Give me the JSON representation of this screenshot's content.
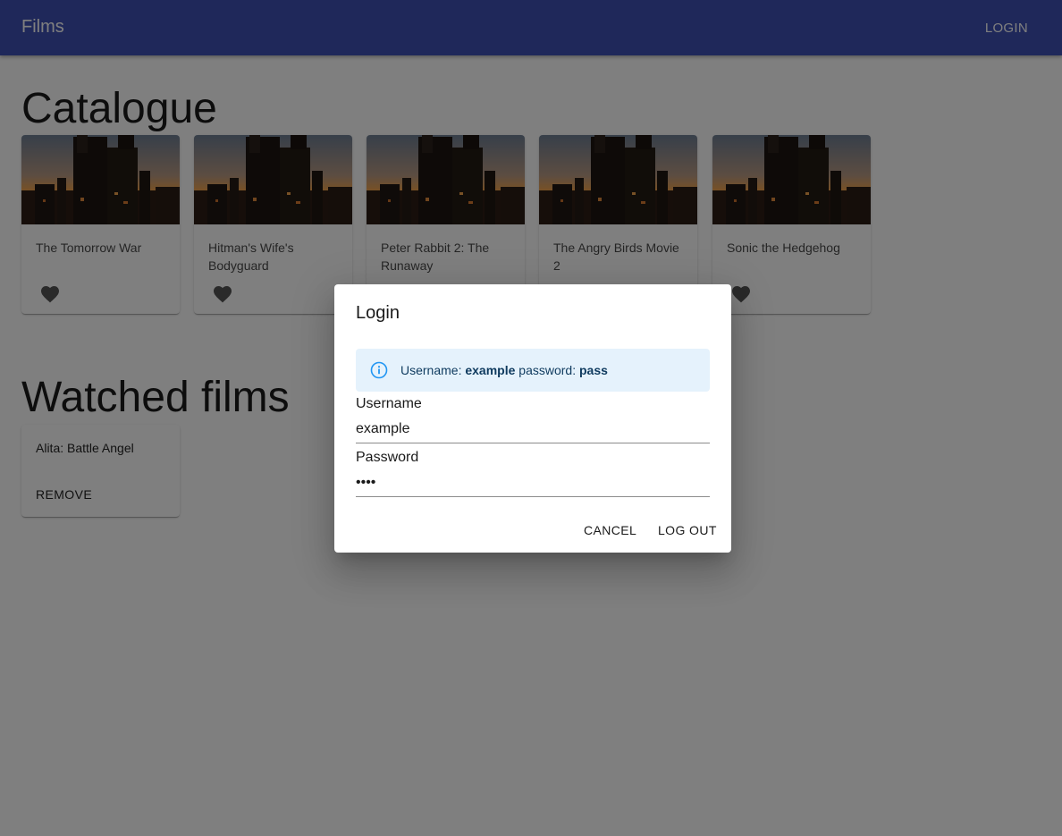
{
  "appbar": {
    "title": "Films",
    "login_label": "LOGIN"
  },
  "catalogue": {
    "heading": "Catalogue",
    "films": [
      {
        "title": "The Tomorrow War"
      },
      {
        "title": "Hitman's Wife's Bodyguard"
      },
      {
        "title": "Peter Rabbit 2: The Runaway"
      },
      {
        "title": "The Angry Birds Movie 2"
      },
      {
        "title": "Sonic the Hedgehog"
      }
    ]
  },
  "watched": {
    "heading": "Watched films",
    "items": [
      {
        "title": "Alita: Battle Angel",
        "remove_label": "REMOVE"
      }
    ]
  },
  "dialog": {
    "title": "Login",
    "alert": {
      "prefix_user": "Username:",
      "username": "example",
      "prefix_pass": "password:",
      "password": "pass"
    },
    "username": {
      "label": "Username",
      "value": "example"
    },
    "password": {
      "label": "Password",
      "value": "pass"
    },
    "cancel_label": "CANCEL",
    "logout_label": "LOG OUT"
  },
  "icons": {
    "favorite": "heart-icon",
    "info": "info-circle-icon"
  },
  "colors": {
    "appbar": "#3f51b5",
    "alert_bg": "#e5f2fc",
    "alert_icon": "#2196f3"
  }
}
